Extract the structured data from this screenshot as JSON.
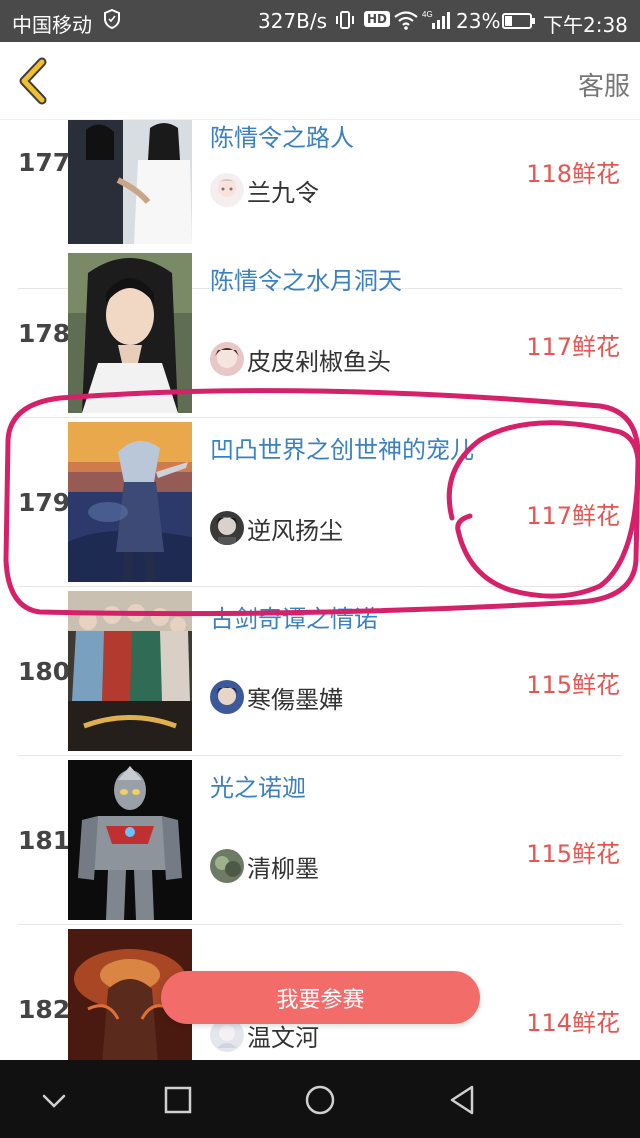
{
  "status_bar": {
    "carrier": "中国移动",
    "speed": "327B/s",
    "hd_label": "HD",
    "battery": "23%",
    "time": "下午2:38",
    "icons": [
      "shield-icon",
      "vibrate-icon",
      "wifi-icon",
      "signal-icon",
      "battery-icon"
    ]
  },
  "header": {
    "back_icon": "chevron-left-icon",
    "service_label": "客服",
    "accent_color": "#f0c030"
  },
  "list": {
    "rows": [
      {
        "rank": "177",
        "title": "陈情令之路人",
        "author": "兰九令",
        "flowers": "118鲜花"
      },
      {
        "rank": "178",
        "title": "陈情令之水月洞天",
        "author": "皮皮剁椒鱼头",
        "flowers": "117鲜花"
      },
      {
        "rank": "179",
        "title": "凹凸世界之创世神的宠儿",
        "author": "逆风扬尘",
        "flowers": "117鲜花"
      },
      {
        "rank": "180",
        "title": "古剑奇谭之情诺",
        "author": "寒傷墨嬅",
        "flowers": "115鲜花"
      },
      {
        "rank": "181",
        "title": "光之诺迦",
        "author": "清柳墨",
        "flowers": "115鲜花"
      },
      {
        "rank": "182",
        "title": "",
        "author": "温文河",
        "flowers": "114鲜花"
      }
    ]
  },
  "join_button": {
    "label": "我要参赛"
  },
  "nav_bar": {
    "icons": [
      "chevron-down-icon",
      "square-icon",
      "circle-icon",
      "triangle-back-icon"
    ]
  },
  "colors": {
    "title": "#3b80c0",
    "flowers": "#e8544f",
    "button": "#f26d6a",
    "annotation": "#d6206a"
  }
}
